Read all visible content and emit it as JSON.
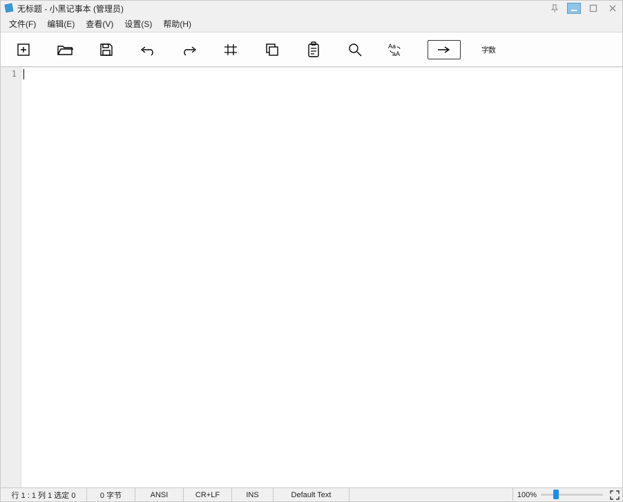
{
  "title": "无标题 - 小黑记事本 (管理员)",
  "menu": {
    "file": "文件(F)",
    "edit": "编辑(E)",
    "view": "查看(V)",
    "settings": "设置(S)",
    "help": "帮助(H)"
  },
  "toolbar": {
    "wordcount_label": "字数"
  },
  "editor": {
    "line_number": "1",
    "content": ""
  },
  "status": {
    "position": "行 1 : 1  列 1  选定 0",
    "bytes": "0 字节",
    "encoding": "ANSI",
    "eol": "CR+LF",
    "mode": "INS",
    "filetype": "Default Text",
    "zoom": "100%"
  }
}
